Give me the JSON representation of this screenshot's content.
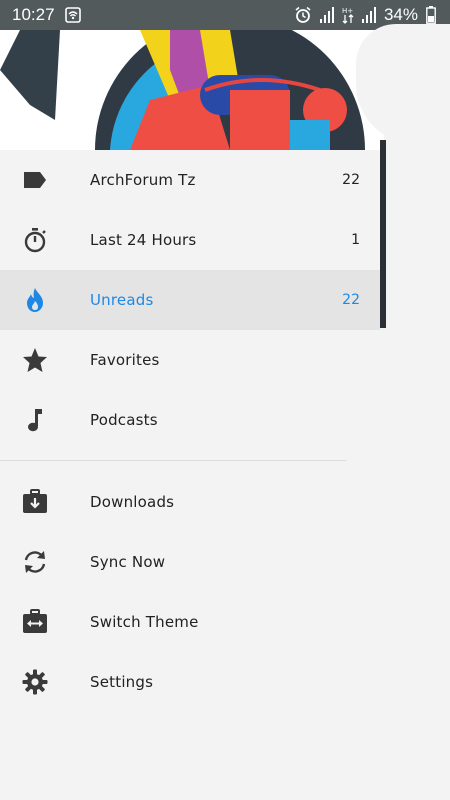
{
  "status_bar": {
    "time": "10:27",
    "battery_percent": "34%",
    "icons": [
      "wifi-call-icon",
      "alarm-icon",
      "signal-1-icon",
      "data-arrows-icon",
      "signal-2-icon",
      "battery-icon"
    ]
  },
  "colors": {
    "active_accent": "#1e88e5",
    "status_bar_bg": "#525a5c",
    "drawer_bg": "#f3f3f3",
    "active_row_bg": "#e4e4e4"
  },
  "menu": {
    "primary": [
      {
        "label": "ArchForum Tz",
        "count": "22",
        "icon": "label-tag-icon"
      },
      {
        "label": "Last 24 Hours",
        "count": "1",
        "icon": "stopwatch-icon"
      },
      {
        "label": "Unreads",
        "count": "22",
        "icon": "flame-icon",
        "active": true
      },
      {
        "label": "Favorites",
        "count": "",
        "icon": "star-icon"
      },
      {
        "label": "Podcasts",
        "count": "",
        "icon": "music-note-icon"
      }
    ],
    "secondary": [
      {
        "label": "Downloads",
        "icon": "download-box-icon"
      },
      {
        "label": "Sync Now",
        "icon": "sync-icon"
      },
      {
        "label": "Switch Theme",
        "icon": "switch-box-icon"
      },
      {
        "label": "Settings",
        "icon": "gear-icon"
      }
    ]
  }
}
